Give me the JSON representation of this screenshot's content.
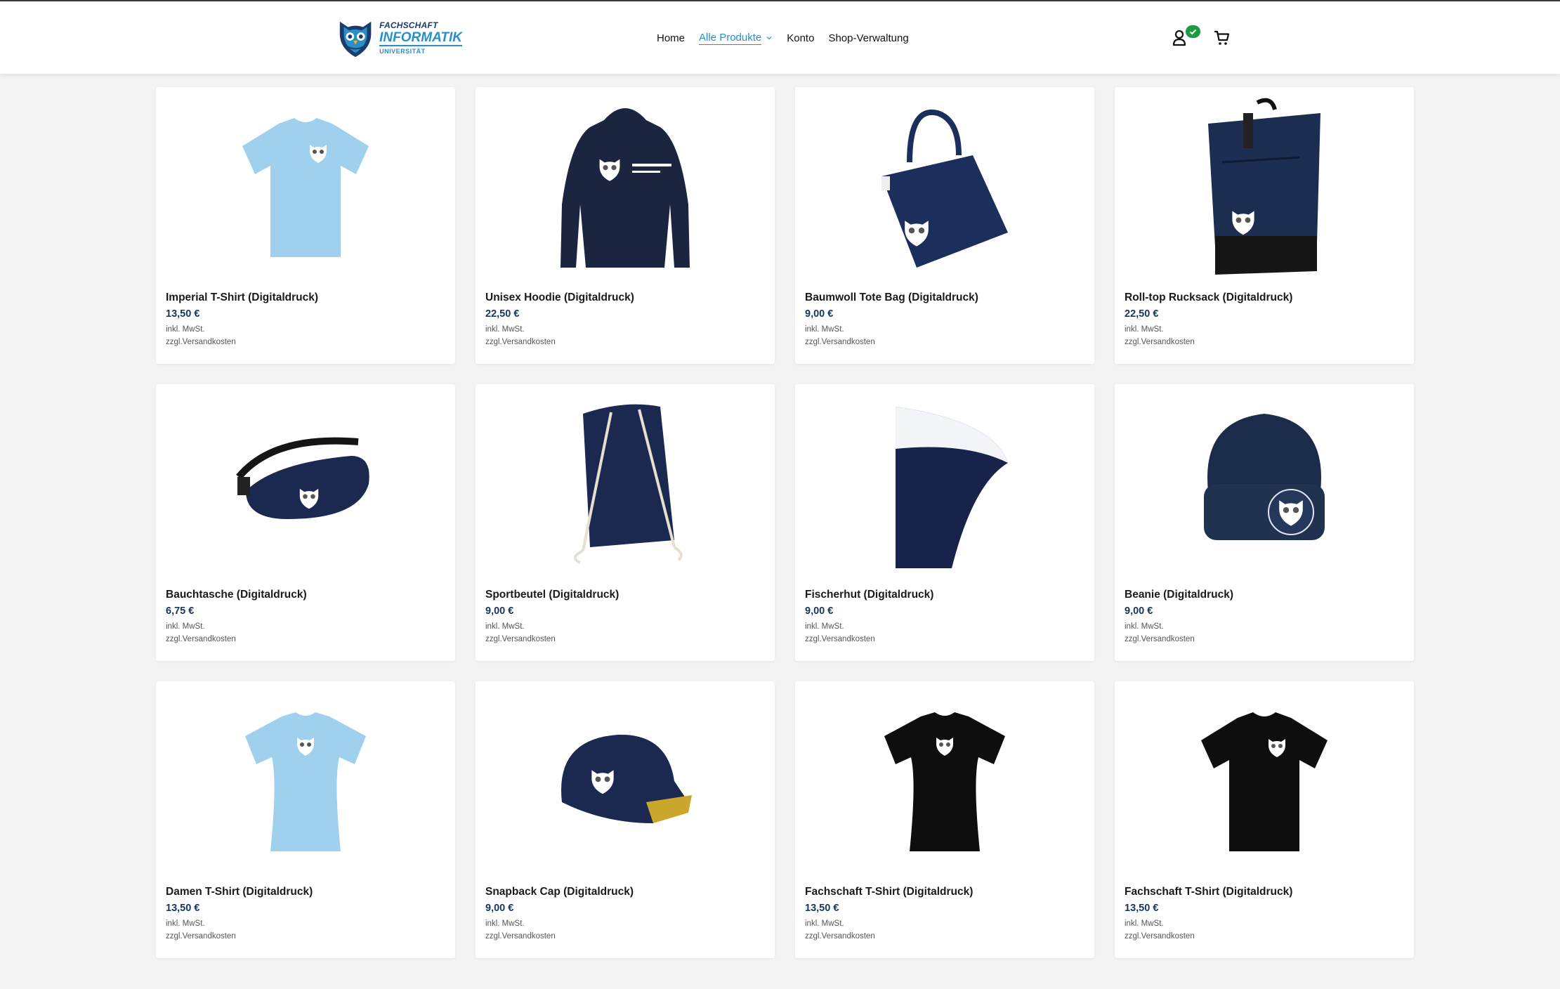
{
  "brand": {
    "line1": "FACHSCHAFT",
    "line2": "INFORMATIK",
    "line3": "UNIVERSITÄT"
  },
  "colors": {
    "accent": "#2a8fc9",
    "navy": "#17365d",
    "badge_green": "#1d9a44"
  },
  "nav": {
    "home": "Home",
    "products": "Alle Produkte",
    "account": "Konto",
    "admin": "Shop-Verwaltung"
  },
  "header_icons": {
    "account": "user-icon",
    "account_badge": "check-icon",
    "cart": "cart-icon"
  },
  "products": [
    {
      "name": "Imperial T-Shirt (Digitaldruck)",
      "price": "13,50 €",
      "tax": "inkl. MwSt.",
      "shipping": "zzgl.Versandkosten",
      "image": "tshirt-icon",
      "color": "#9fd0ee"
    },
    {
      "name": "Unisex Hoodie (Digitaldruck)",
      "price": "22,50 €",
      "tax": "inkl. MwSt.",
      "shipping": "zzgl.Versandkosten",
      "image": "hoodie-icon",
      "color": "#1b2540"
    },
    {
      "name": "Baumwoll Tote Bag (Digitaldruck)",
      "price": "9,00 €",
      "tax": "inkl. MwSt.",
      "shipping": "zzgl.Versandkosten",
      "image": "tote-bag-icon",
      "color": "#1b2e5c"
    },
    {
      "name": "Roll-top Rucksack (Digitaldruck)",
      "price": "22,50 €",
      "tax": "inkl. MwSt.",
      "shipping": "zzgl.Versandkosten",
      "image": "backpack-icon",
      "color": "#1b2e52"
    },
    {
      "name": "Bauchtasche (Digitaldruck)",
      "price": "6,75 €",
      "tax": "inkl. MwSt.",
      "shipping": "zzgl.Versandkosten",
      "image": "fanny-pack-icon",
      "color": "#1b2850"
    },
    {
      "name": "Sportbeutel (Digitaldruck)",
      "price": "9,00 €",
      "tax": "inkl. MwSt.",
      "shipping": "zzgl.Versandkosten",
      "image": "gym-bag-icon",
      "color": "#1b2850"
    },
    {
      "name": "Fischerhut (Digitaldruck)",
      "price": "9,00 €",
      "tax": "inkl. MwSt.",
      "shipping": "zzgl.Versandkosten",
      "image": "bucket-hat-icon",
      "color": "#17234a"
    },
    {
      "name": "Beanie (Digitaldruck)",
      "price": "9,00 €",
      "tax": "inkl. MwSt.",
      "shipping": "zzgl.Versandkosten",
      "image": "beanie-icon",
      "color": "#1b2b4a"
    },
    {
      "name": "Damen T-Shirt (Digitaldruck)",
      "price": "13,50 €",
      "tax": "inkl. MwSt.",
      "shipping": "zzgl.Versandkosten",
      "image": "women-tshirt-icon",
      "color": "#9fd0ee"
    },
    {
      "name": "Snapback Cap (Digitaldruck)",
      "price": "9,00 €",
      "tax": "inkl. MwSt.",
      "shipping": "zzgl.Versandkosten",
      "image": "cap-icon",
      "color": "#1b2850"
    },
    {
      "name": "Fachschaft T-Shirt (Digitaldruck)",
      "price": "13,50 €",
      "tax": "inkl. MwSt.",
      "shipping": "zzgl.Versandkosten",
      "image": "women-tshirt-icon",
      "color": "#0e0e0e"
    },
    {
      "name": "Fachschaft T-Shirt (Digitaldruck)",
      "price": "13,50 €",
      "tax": "inkl. MwSt.",
      "shipping": "zzgl.Versandkosten",
      "image": "tshirt-icon",
      "color": "#0e0e0e"
    }
  ]
}
